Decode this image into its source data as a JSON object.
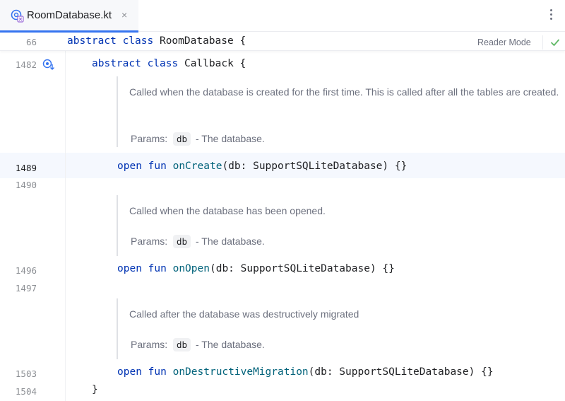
{
  "tab": {
    "filename": "RoomDatabase.kt",
    "close_glyph": "×"
  },
  "toolbar": {
    "reader_mode": "Reader Mode"
  },
  "sticky": {
    "line": "66",
    "kw1": "abstract",
    "kw2": "class",
    "rest": "RoomDatabase {"
  },
  "lines": {
    "l1482": "1482",
    "l1489": "1489",
    "l1490": "1490",
    "l1496": "1496",
    "l1497": "1497",
    "l1503": "1503",
    "l1504": "1504"
  },
  "code": {
    "callback_kw1": "abstract",
    "callback_kw2": "class",
    "callback_rest": "Callback {",
    "open": "open",
    "fun": "fun",
    "oncreate_name": "onCreate",
    "oncreate_args": "(db: SupportSQLiteDatabase) {}",
    "onopen_name": "onOpen",
    "onopen_args": "(db: SupportSQLiteDatabase) {}",
    "ondestr_name": "onDestructiveMigration",
    "ondestr_args": "(db: SupportSQLiteDatabase) {}",
    "close_brace": "}"
  },
  "docs": [
    {
      "text": "Called when the database is created for the first time. This is called after all the tables are created.",
      "params_label": "Params:",
      "param": "db",
      "param_desc": "- The database."
    },
    {
      "text": "Called when the database has been opened.",
      "params_label": "Params:",
      "param": "db",
      "param_desc": "- The database."
    },
    {
      "text": "Called after the database was destructively migrated",
      "params_label": "Params:",
      "param": "db",
      "param_desc": "- The database."
    }
  ],
  "colors": {
    "keyword": "#0033b3",
    "function": "#00627a",
    "accent": "#3574f0",
    "check": "#5fb865"
  },
  "icons": {
    "file": "kotlin-file-icon",
    "override": "override-method-icon",
    "check": "check-icon",
    "more": "more-vertical-icon"
  }
}
